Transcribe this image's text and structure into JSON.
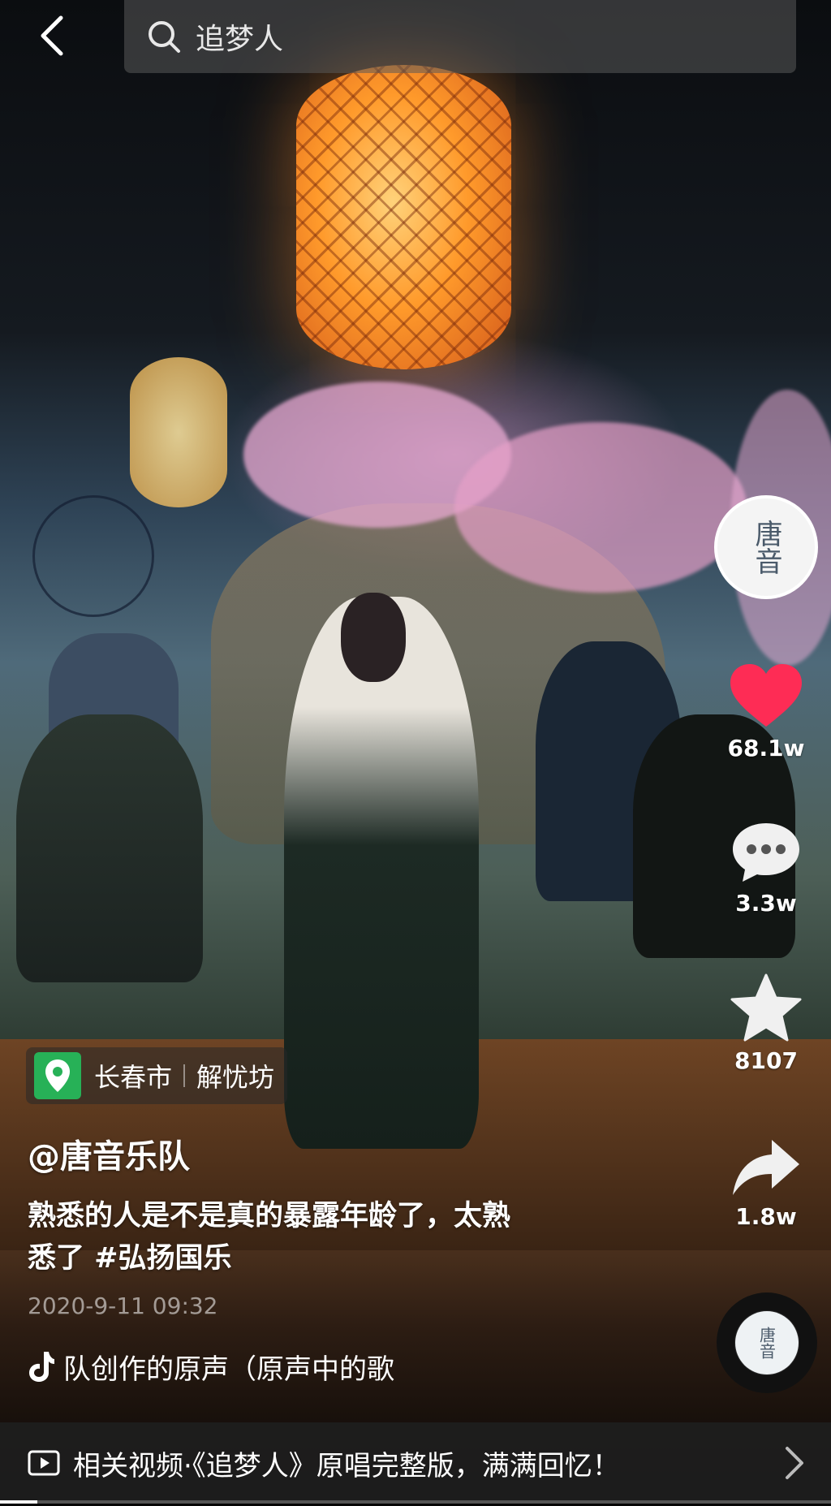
{
  "search": {
    "query": "追梦人"
  },
  "video": {
    "location_city": "长春市",
    "location_place": "解忧坊",
    "author": "@唐音乐队",
    "caption_line1": "熟悉的人是不是真的暴露年龄了，太熟",
    "caption_line2": "悉了 #弘扬国乐",
    "date": "2020-9-11 09:32",
    "music": "队创作的原声（原声中的歌",
    "avatar_text": "唐音"
  },
  "actions": {
    "likes": "68.1w",
    "comments": "3.3w",
    "favorites": "8107",
    "shares": "1.8w"
  },
  "related": {
    "text": "相关视频·《追梦人》原唱完整版，满满回忆！"
  },
  "progress": {
    "fraction": 0.045
  },
  "colors": {
    "like": "#fe2c55",
    "location_pin": "#27b157"
  }
}
